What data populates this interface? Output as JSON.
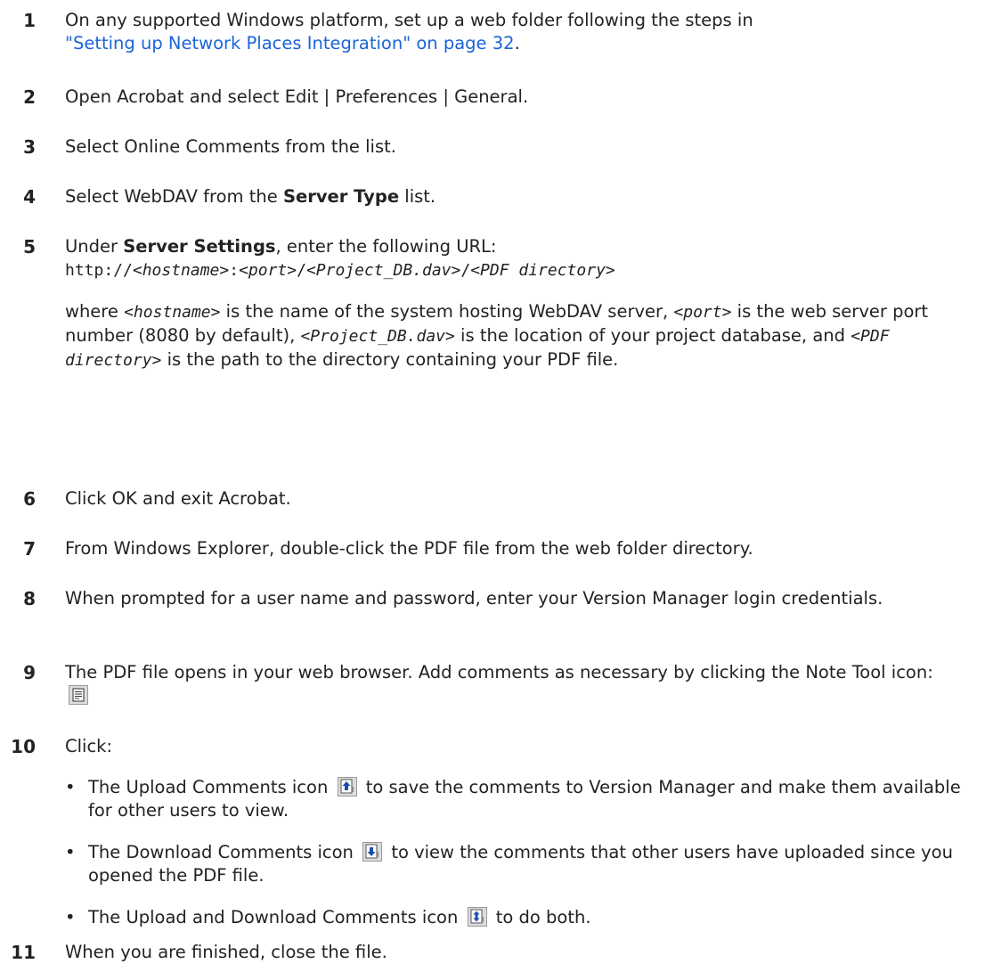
{
  "steps": [
    {
      "num": "1",
      "text_a": "On any supported Windows platform, set up a web folder following the steps in",
      "link": "\"Setting up Network Places Integration\" on page 32",
      "text_b": "."
    },
    {
      "num": "2",
      "text": "Open Acrobat and select Edit | Preferences | General."
    },
    {
      "num": "3",
      "text": "Select Online Comments from the list."
    },
    {
      "num": "4",
      "text_a": "Select WebDAV from the ",
      "bold": "Server Type",
      "text_b": " list."
    },
    {
      "num": "5",
      "text_a": "Under ",
      "bold": "Server Settings",
      "text_b": ", enter the following URL:",
      "url": {
        "p1": "http://",
        "hostname": "<hostname>",
        "sep1": ":",
        "port": "<port>",
        "sep2": "/",
        "project": "<Project_DB.dav>",
        "sep3": "/",
        "pdfdir": "<PDF directory>"
      },
      "where": {
        "w1": "where ",
        "hostname": "<hostname>",
        "w2": " is the name of the system hosting WebDAV server, ",
        "port": "<port>",
        "w3": " is the web server port number (8080 by default), ",
        "project": "<Project_DB.dav>",
        "w4": " is the location of your project database, and ",
        "pdfdir": "<PDF directory>",
        "w5": " is the path to the directory containing your PDF file."
      }
    },
    {
      "num": "6",
      "text": "Click OK and exit Acrobat."
    },
    {
      "num": "7",
      "text": "From Windows Explorer, double-click the PDF file from the web folder directory."
    },
    {
      "num": "8",
      "text": "When prompted for a user name and password, enter your Version Manager login credentials."
    },
    {
      "num": "9",
      "text": "The PDF file opens in your web browser. Add comments as necessary by clicking the Note Tool icon:"
    },
    {
      "num": "10",
      "text": "Click:",
      "bullets": [
        {
          "a": "The Upload Comments icon ",
          "b": " to save the comments to Version Manager and make them available for other users to view."
        },
        {
          "a": "The Download Comments icon ",
          "b": " to view the comments that other users have uploaded since you opened the PDF file."
        },
        {
          "a": "The Upload and Download Comments icon ",
          "b": " to do both."
        }
      ]
    },
    {
      "num": "11",
      "text": "When you are finished, close the file."
    }
  ],
  "bullet_char": "•",
  "colors": {
    "text": "#222222",
    "link": "#1a64d8",
    "icon_bg": "#dcdcdc",
    "icon_arrow": "#1b4fa8"
  }
}
